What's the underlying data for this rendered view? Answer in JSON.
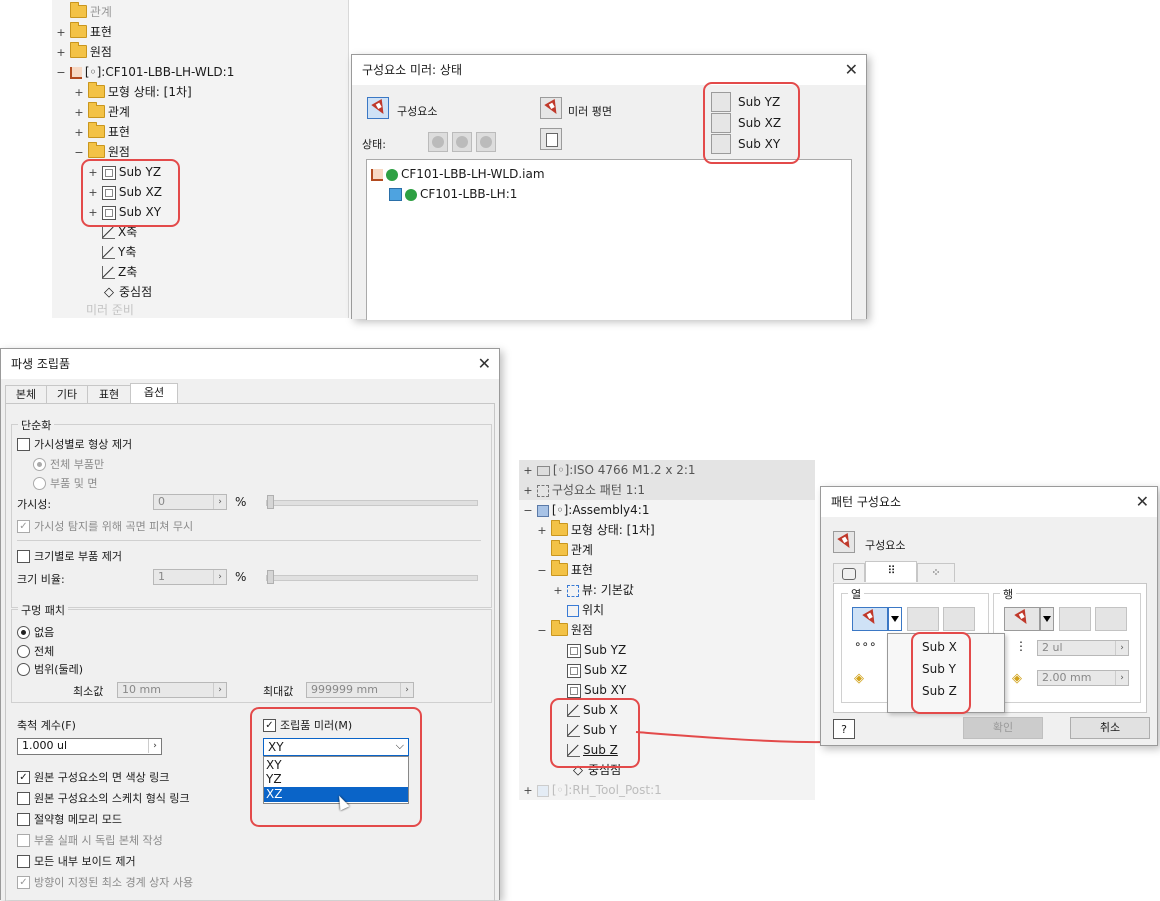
{
  "tree1": {
    "rows": [
      "관계",
      "표현",
      "원점",
      "[◦]:CF101-LBB-LH-WLD:1",
      "모형 상태: [1차]",
      "관계",
      "표현",
      "원점",
      "Sub YZ",
      "Sub XZ",
      "Sub XY",
      "X축",
      "Y축",
      "Z축",
      "중심점",
      "미러 준비"
    ]
  },
  "mirror_dialog": {
    "title": "구성요소 미러: 상태",
    "close": "✕",
    "component_label": "구성요소",
    "mirror_plane_label": "미러 평면",
    "status_label": "상태:",
    "plane_options": [
      "Sub YZ",
      "Sub XZ",
      "Sub XY"
    ],
    "list": [
      "CF101-LBB-LH-WLD.iam",
      "CF101-LBB-LH:1"
    ]
  },
  "derived_dialog": {
    "title": "파생 조립품",
    "close": "✕",
    "tabs": [
      "본체",
      "기타",
      "표현",
      "옵션"
    ],
    "simplify_group": "단순화",
    "remove_by_visibility": "가시성별로 형상 제거",
    "radio_all_parts": "전체 부품만",
    "radio_parts_faces": "부품 및 면",
    "visibility_label": "가시성:",
    "visibility_value": "0",
    "percent": "%",
    "ignore_surfaces": "가시성 탐지를 위해 곡면 피쳐 무시",
    "remove_by_size": "크기별로 부품 제거",
    "size_ratio_label": "크기 비율:",
    "size_ratio_value": "1",
    "hole_patch_group": "구멍 패치",
    "hole_none": "없음",
    "hole_all": "전체",
    "hole_range": "범위(둘레)",
    "min_label": "최소값",
    "min_value": "10 mm",
    "max_label": "최대값",
    "max_value": "999999 mm",
    "scale_label": "축척 계수(F)",
    "scale_value": "1.000 ul",
    "mirror_assembly": "조립품 미러(M)",
    "mirror_plane_selected": "XY",
    "mirror_plane_options": [
      "XY",
      "YZ",
      "XZ"
    ],
    "link_face_color": "원본 구성요소의 면 색상 링크",
    "link_sketch_style": "원본 구성요소의 스케치 형식 링크",
    "memory_saving": "절약형 메모리 모드",
    "independent_body": "부울 실패 시 독립 본체 작성",
    "remove_voids": "모든 내부 보이드 제거",
    "oriented_box": "방향이 지정된 최소 경계 상자 사용"
  },
  "tree2": {
    "rows": [
      "[◦]:ISO 4766 M1.2 x 2:1",
      "구성요소 패턴 1:1",
      "[◦]:Assembly4:1",
      "모형 상태: [1차]",
      "관계",
      "표현",
      "뷰: 기본값",
      "위치",
      "원점",
      "Sub YZ",
      "Sub XZ",
      "Sub XY",
      "Sub X",
      "Sub Y",
      "Sub Z",
      "중심점",
      "[◦]:RH_Tool_Post:1"
    ]
  },
  "pattern_dialog": {
    "title": "패턴 구성요소",
    "close": "✕",
    "component_label": "구성요소",
    "col_group": "열",
    "row_group": "행",
    "col_menu": [
      "Sub X",
      "Sub Y",
      "Sub Z"
    ],
    "row_count": "2 ul",
    "row_spacing": "2.00 mm",
    "help": "?",
    "ok": "확인",
    "cancel": "취소"
  },
  "colors": {
    "highlight": "#e34a4a",
    "selection": "#0a64c8",
    "folder": "#f3c246"
  }
}
